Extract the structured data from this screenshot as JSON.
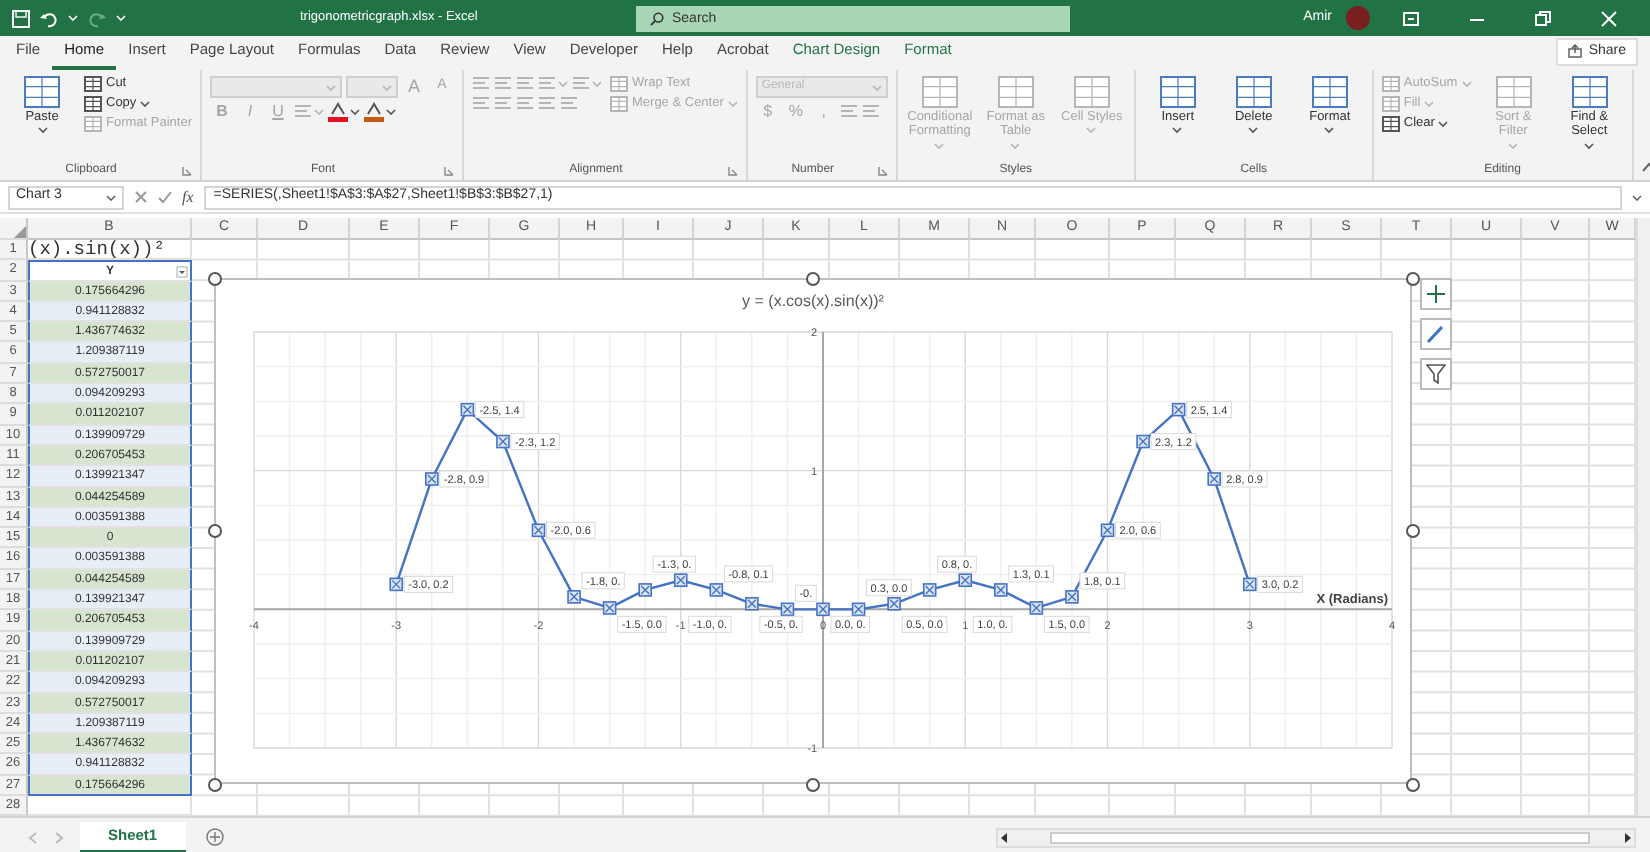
{
  "title_bar": {
    "file_title": "trigonometricgraph.xlsx  -  Excel",
    "search": {
      "placeholder": "Search"
    },
    "user": "Amir"
  },
  "tabs": [
    {
      "label": "File",
      "selected": false,
      "contextual": false
    },
    {
      "label": "Home",
      "selected": true,
      "contextual": false
    },
    {
      "label": "Insert",
      "selected": false,
      "contextual": false
    },
    {
      "label": "Page Layout",
      "selected": false,
      "contextual": false
    },
    {
      "label": "Formulas",
      "selected": false,
      "contextual": false
    },
    {
      "label": "Data",
      "selected": false,
      "contextual": false
    },
    {
      "label": "Review",
      "selected": false,
      "contextual": false
    },
    {
      "label": "View",
      "selected": false,
      "contextual": false
    },
    {
      "label": "Developer",
      "selected": false,
      "contextual": false
    },
    {
      "label": "Help",
      "selected": false,
      "contextual": false
    },
    {
      "label": "Acrobat",
      "selected": false,
      "contextual": false
    },
    {
      "label": "Chart Design",
      "selected": false,
      "contextual": true
    },
    {
      "label": "Format",
      "selected": false,
      "contextual": true
    }
  ],
  "share": "Share",
  "ribbon": [
    {
      "label": "Clipboard",
      "launcher": true,
      "columns": [
        [
          [
            {
              "kind": "large",
              "text": "Paste",
              "menu": true,
              "disabled": false
            }
          ]
        ],
        [
          [
            {
              "kind": "small",
              "text": "Cut",
              "menu": false,
              "disabled": false
            }
          ],
          [
            {
              "kind": "small",
              "text": "Copy",
              "menu": true,
              "disabled": false
            }
          ],
          [
            {
              "kind": "small",
              "text": "Format Painter",
              "menu": false,
              "disabled": true
            }
          ]
        ]
      ]
    },
    {
      "label": "Font",
      "launcher": true,
      "columns": [
        [
          [
            {
              "kind": "field",
              "disabled": true
            },
            {
              "kind": "smallfield",
              "disabled": true
            },
            {
              "kind": "char",
              "text": "A",
              "disabled": true
            },
            {
              "kind": "char",
              "text": "A",
              "disabled": true
            }
          ],
          [
            {
              "kind": "char",
              "text": "B",
              "disabled": true
            },
            {
              "kind": "char",
              "text": "I",
              "disabled": true
            },
            {
              "kind": "char",
              "text": "U",
              "disabled": true
            },
            {
              "kind": "icon",
              "menu": true,
              "disabled": true
            },
            {
              "kind": "icon",
              "menu": true,
              "color": "#e81123",
              "disabled": false
            },
            {
              "kind": "icon",
              "menu": true,
              "color": "#c55a11",
              "disabled": false
            }
          ]
        ]
      ]
    },
    {
      "label": "Alignment",
      "launcher": true,
      "columns": [
        [
          [
            {
              "kind": "icon",
              "menu": false,
              "disabled": true
            },
            {
              "kind": "icon",
              "menu": false,
              "disabled": true
            },
            {
              "kind": "icon",
              "menu": false,
              "disabled": true
            },
            {
              "kind": "icon",
              "menu": true,
              "disabled": true
            },
            {
              "kind": "icon",
              "menu": true,
              "disabled": true
            }
          ],
          [
            {
              "kind": "icon",
              "menu": false,
              "disabled": true
            },
            {
              "kind": "icon",
              "menu": false,
              "disabled": true
            },
            {
              "kind": "icon",
              "menu": false,
              "disabled": true
            },
            {
              "kind": "icon",
              "menu": false,
              "disabled": true
            },
            {
              "kind": "icon",
              "menu": false,
              "disabled": true
            }
          ]
        ],
        [
          [
            {
              "kind": "small",
              "text": "Wrap Text",
              "menu": false,
              "disabled": true
            }
          ],
          [
            {
              "kind": "small",
              "text": "Merge & Center",
              "menu": true,
              "disabled": true
            }
          ]
        ]
      ]
    },
    {
      "label": "Number",
      "launcher": true,
      "columns": [
        [
          [
            {
              "kind": "field",
              "placeholder": "General",
              "disabled": true
            }
          ],
          [
            {
              "kind": "char",
              "text": "$",
              "disabled": true
            },
            {
              "kind": "char",
              "text": "%",
              "disabled": true
            },
            {
              "kind": "char",
              "text": ",",
              "disabled": true
            },
            {
              "kind": "icon",
              "menu": false,
              "disabled": true
            },
            {
              "kind": "icon",
              "menu": false,
              "disabled": true
            }
          ]
        ]
      ]
    },
    {
      "label": "Styles",
      "launcher": false,
      "columns": [
        [
          [
            {
              "kind": "large",
              "text": "Conditional Formatting",
              "menu": true,
              "disabled": true
            }
          ]
        ],
        [
          [
            {
              "kind": "large",
              "text": "Format as Table",
              "menu": true,
              "disabled": true
            }
          ]
        ],
        [
          [
            {
              "kind": "large",
              "text": "Cell Styles",
              "menu": true,
              "disabled": true
            }
          ]
        ]
      ]
    },
    {
      "label": "Cells",
      "launcher": false,
      "columns": [
        [
          [
            {
              "kind": "large",
              "text": "Insert",
              "menu": true,
              "disabled": false
            }
          ]
        ],
        [
          [
            {
              "kind": "large",
              "text": "Delete",
              "menu": true,
              "disabled": false
            }
          ]
        ],
        [
          [
            {
              "kind": "large",
              "text": "Format",
              "menu": true,
              "disabled": false
            }
          ]
        ]
      ]
    },
    {
      "label": "Editing",
      "launcher": false,
      "columns": [
        [
          [
            {
              "kind": "small",
              "text": "AutoSum",
              "menu": true,
              "disabled": true
            }
          ],
          [
            {
              "kind": "small",
              "text": "Fill",
              "menu": true,
              "disabled": true
            }
          ],
          [
            {
              "kind": "small",
              "text": "Clear",
              "menu": true,
              "disabled": false
            }
          ]
        ],
        [
          [
            {
              "kind": "large",
              "text": "Sort & Filter",
              "menu": true,
              "disabled": true
            }
          ]
        ],
        [
          [
            {
              "kind": "large",
              "text": "Find & Select",
              "menu": true,
              "disabled": false
            }
          ]
        ]
      ]
    }
  ],
  "formula_bar": {
    "name_box": "Chart 3",
    "fx": "fx",
    "formula": "=SERIES(,Sheet1!$A$3:$A$27,Sheet1!$B$3:$B$27,1)"
  },
  "columns": [
    "B",
    "C",
    "D",
    "E",
    "F",
    "G",
    "H",
    "I",
    "J",
    "K",
    "L",
    "M",
    "N",
    "O",
    "P",
    "Q",
    "R",
    "S",
    "T",
    "U",
    "V",
    "W"
  ],
  "rows": [
    {
      "number": "1",
      "kind": "title",
      "value": "(x).sin(x))²",
      "highlighted": false
    },
    {
      "number": "2",
      "kind": "header",
      "value": "Y",
      "highlighted": true
    },
    {
      "number": "3",
      "kind": "value",
      "value": "0.175664296",
      "highlighted": true
    },
    {
      "number": "4",
      "kind": "value",
      "value": "0.941128832",
      "highlighted": true
    },
    {
      "number": "5",
      "kind": "value",
      "value": "1.436774632",
      "highlighted": true
    },
    {
      "number": "6",
      "kind": "value",
      "value": "1.209387119",
      "highlighted": true
    },
    {
      "number": "7",
      "kind": "value",
      "value": "0.572750017",
      "highlighted": true
    },
    {
      "number": "8",
      "kind": "value",
      "value": "0.094209293",
      "highlighted": true
    },
    {
      "number": "9",
      "kind": "value",
      "value": "0.011202107",
      "highlighted": true
    },
    {
      "number": "10",
      "kind": "value",
      "value": "0.139909729",
      "highlighted": true
    },
    {
      "number": "11",
      "kind": "value",
      "value": "0.206705453",
      "highlighted": true
    },
    {
      "number": "12",
      "kind": "value",
      "value": "0.139921347",
      "highlighted": true
    },
    {
      "number": "13",
      "kind": "value",
      "value": "0.044254589",
      "highlighted": true
    },
    {
      "number": "14",
      "kind": "value",
      "value": "0.003591388",
      "highlighted": true
    },
    {
      "number": "15",
      "kind": "value",
      "value": "0",
      "highlighted": true
    },
    {
      "number": "16",
      "kind": "value",
      "value": "0.003591388",
      "highlighted": true
    },
    {
      "number": "17",
      "kind": "value",
      "value": "0.044254589",
      "highlighted": true
    },
    {
      "number": "18",
      "kind": "value",
      "value": "0.139921347",
      "highlighted": true
    },
    {
      "number": "19",
      "kind": "value",
      "value": "0.206705453",
      "highlighted": true
    },
    {
      "number": "20",
      "kind": "value",
      "value": "0.139909729",
      "highlighted": true
    },
    {
      "number": "21",
      "kind": "value",
      "value": "0.011202107",
      "highlighted": true
    },
    {
      "number": "22",
      "kind": "value",
      "value": "0.094209293",
      "highlighted": true
    },
    {
      "number": "23",
      "kind": "value",
      "value": "0.572750017",
      "highlighted": true
    },
    {
      "number": "24",
      "kind": "value",
      "value": "1.209387119",
      "highlighted": true
    },
    {
      "number": "25",
      "kind": "value",
      "value": "1.436774632",
      "highlighted": true
    },
    {
      "number": "26",
      "kind": "value",
      "value": "0.941128832",
      "highlighted": true
    },
    {
      "number": "27",
      "kind": "value",
      "value": "0.175664296",
      "highlighted": true
    },
    {
      "number": "28",
      "kind": "empty",
      "highlighted": false
    }
  ],
  "chart": {
    "chart_data": {
      "type": "line",
      "title": "y = (x.cos(x).sin(x))²",
      "xlabel": "X (Radians)",
      "x": [
        -3,
        -2.75,
        -2.5,
        -2.25,
        -2,
        -1.75,
        -1.5,
        -1.25,
        -1,
        -0.75,
        -0.5,
        -0.25,
        0,
        0.25,
        0.5,
        0.75,
        1,
        1.25,
        1.5,
        1.75,
        2,
        2.25,
        2.5,
        2.75,
        3
      ],
      "series": [
        {
          "color": "#4472c4",
          "marker": true,
          "values": [
            0.18,
            0.94,
            1.44,
            1.21,
            0.57,
            0.09,
            0.01,
            0.14,
            0.21,
            0.14,
            0.04,
            0,
            0,
            0,
            0.04,
            0.14,
            0.21,
            0.14,
            0.01,
            0.09,
            0.57,
            1.21,
            1.44,
            0.94,
            0.18
          ],
          "value_labels": [
            "-3.0, 0.2",
            "-2.8, 0.9",
            "-2.5, 1.4",
            "-2.3, 1.2",
            "-2.0, 0.6",
            "-1.8, 0.",
            "-1.5, 0.0",
            "-1.3, 0.",
            "-1.0, 0.",
            "-0.8, 0.1",
            "-0.5, 0.",
            "-0.",
            "0.0, 0.",
            "0.3, 0.0",
            "0.5, 0.0",
            "0.8, 0.",
            "1.0, 0.",
            "1.3, 0.1",
            "1.5, 0.0",
            "1.8, 0.1",
            "2.0, 0.6",
            "2.3, 1.2",
            "2.5, 1.4",
            "2.8, 0.9",
            "3.0, 0.2"
          ]
        }
      ],
      "xlim": [
        -4,
        4
      ],
      "ylim": [
        -1,
        2
      ],
      "xticks": [
        -4,
        -3,
        -2,
        -1,
        0,
        1,
        2,
        3,
        4
      ],
      "yticks": [
        -1,
        1,
        2
      ],
      "grid": true,
      "data_labels": true
    }
  },
  "sheets": [
    {
      "label": "Sheet1",
      "selected": true
    }
  ]
}
